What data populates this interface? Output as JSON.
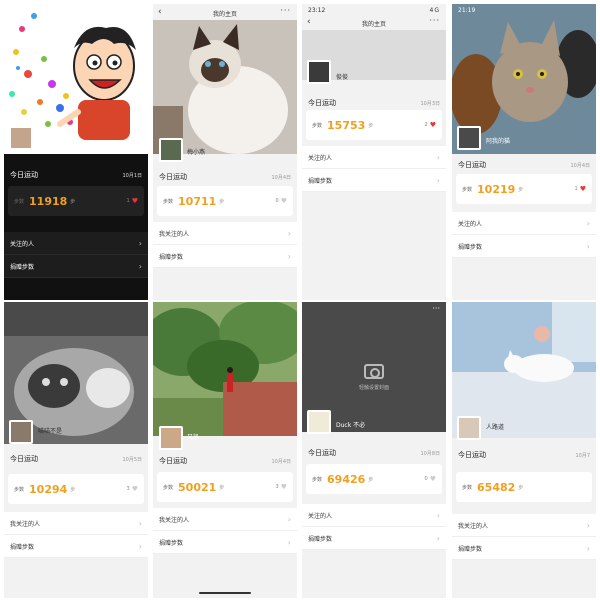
{
  "screens": [
    {
      "username": "",
      "today_label": "今日运动",
      "date": "10月1日",
      "steps_label": "步数",
      "steps": "11918",
      "steps_unit": "步",
      "likes": "1",
      "liked": true,
      "menu": [
        "关注的人",
        "捐赠步数"
      ]
    },
    {
      "title": "我的主页",
      "username": "梅小燕",
      "today_label": "今日运动",
      "date": "10月4日",
      "steps_label": "步数",
      "steps": "10711",
      "steps_unit": "步",
      "likes": "0",
      "liked": false,
      "menu": [
        "我关注的人",
        "捐赠步数"
      ]
    },
    {
      "time": "23:12",
      "status_right": "4G",
      "title": "我的主页",
      "username": "俊俊",
      "today_label": "今日运动",
      "date": "10月3日",
      "steps_label": "步数",
      "steps": "15753",
      "steps_unit": "步",
      "likes": "2",
      "liked": true,
      "menu": [
        "关注的人",
        "捐赠步数"
      ]
    },
    {
      "time": "21:19",
      "username": "阿我的猫",
      "today_label": "今日运动",
      "date": "10月4日",
      "steps_label": "步数",
      "steps": "10219",
      "steps_unit": "步",
      "likes": "1",
      "liked": true,
      "menu": [
        "关注的人",
        "捐赠步数"
      ]
    },
    {
      "username": "喵喵不是",
      "today_label": "今日运动",
      "date": "10月5日",
      "steps_label": "步数",
      "steps": "10294",
      "steps_unit": "步",
      "likes": "3",
      "liked": false,
      "menu": [
        "我关注的人",
        "捐赠步数"
      ]
    },
    {
      "username": "又凯",
      "today_label": "今日运动",
      "date": "10月4日",
      "steps_label": "步数",
      "steps": "50021",
      "steps_unit": "步",
      "likes": "3",
      "liked": false,
      "menu": [
        "我关注的人",
        "捐赠步数"
      ]
    },
    {
      "username": "Duck 不必",
      "cover_hint": "轻触设置封面",
      "today_label": "今日运动",
      "date": "10月8日",
      "steps_label": "步数",
      "steps": "69426",
      "steps_unit": "步",
      "likes": "0",
      "liked": false,
      "menu": [
        "关注的人",
        "捐赠步数"
      ]
    },
    {
      "username": "人路道",
      "today_label": "今日运动",
      "date": "10月7",
      "steps_label": "步数",
      "steps": "65482",
      "steps_unit": "步",
      "menu": [
        "我关注的人",
        "捐赠步数"
      ]
    }
  ]
}
